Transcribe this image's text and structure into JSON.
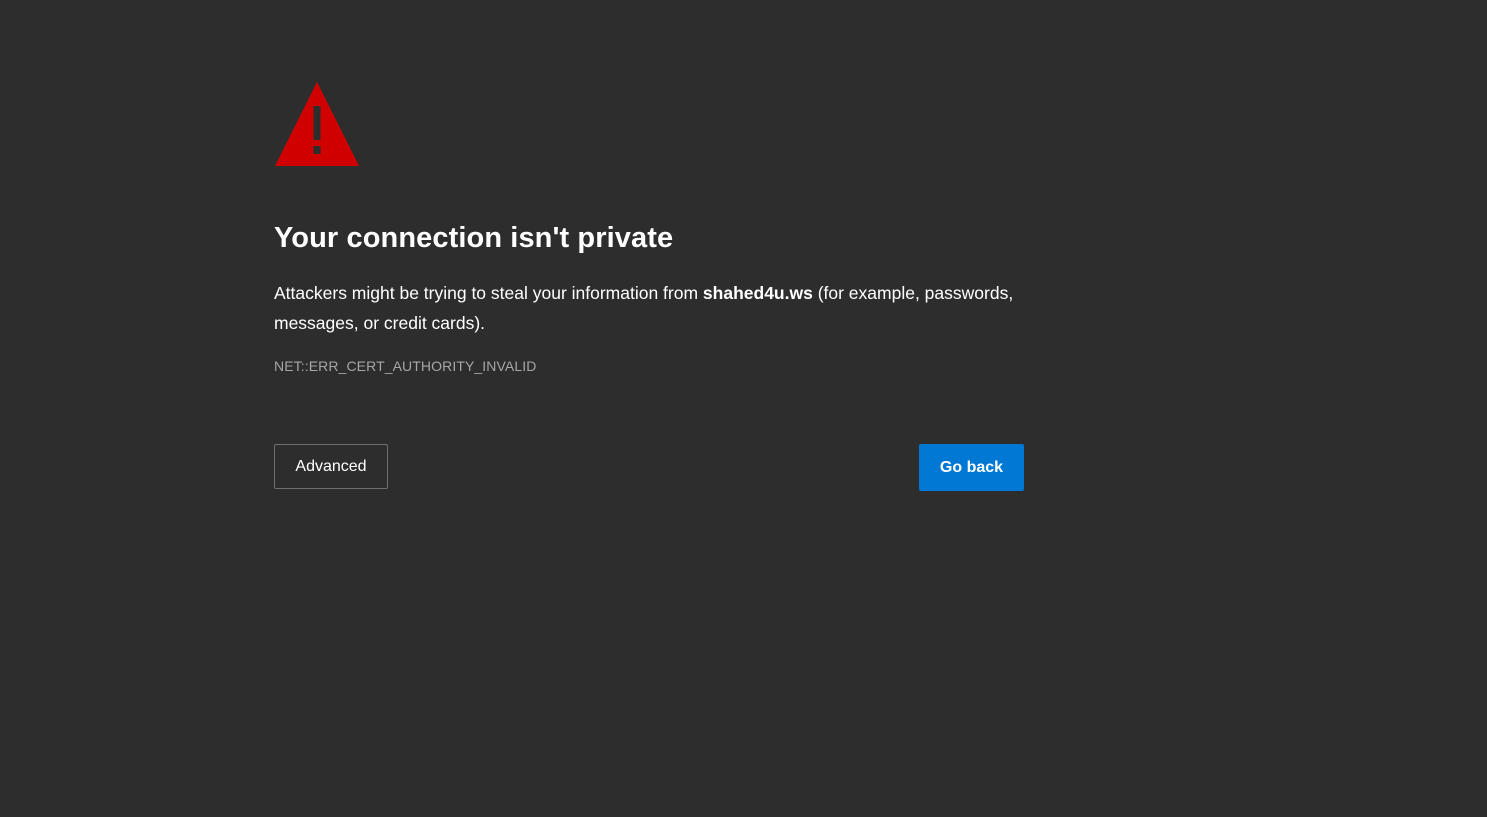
{
  "colors": {
    "background": "#2d2d2d",
    "warning_red": "#d10000",
    "primary_blue": "#0078d4",
    "error_code_gray": "#a6a6a6"
  },
  "icon": {
    "name": "warning-triangle-icon"
  },
  "title": "Your connection isn't private",
  "message": {
    "before": "Attackers might be trying to steal your information from ",
    "host": "shahed4u.ws",
    "after": " (for example, passwords, messages, or credit cards)."
  },
  "error_code": "NET::ERR_CERT_AUTHORITY_INVALID",
  "buttons": {
    "advanced": "Advanced",
    "go_back": "Go back"
  }
}
